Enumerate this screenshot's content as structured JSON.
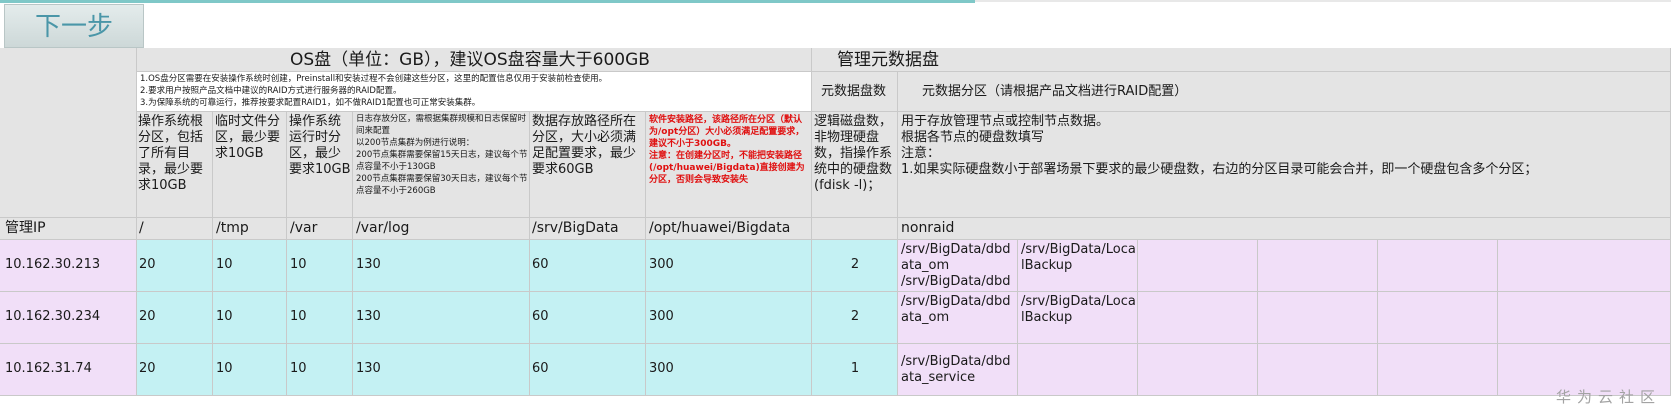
{
  "toolbar": {
    "next_label": "下一步"
  },
  "os_disk": {
    "title": "OS盘（单位：GB），建议OS盘容量大于600GB",
    "notes": "1.OS盘分区需要在安装操作系统时创建，Preinstall和安装过程不会创建这些分区，这里的配置信息仅用于安装前检查使用。\n2.要求用户按照产品文档中建议的RAID方式进行服务器的RAID配置。\n3.为保障系统的可靠运行，推荐按要求配置RAID1，如不做RAID1配置也可正常安装集群。",
    "descriptions": {
      "root": "操作系统根分区，包括了所有目录，最少要求10GB",
      "tmp": "临时文件分区，最少要求10GB",
      "var": "操作系统运行时分区，最少要求10GB",
      "log": "日志存放分区，需根据集群规模和日志保留时间来配置\n以200节点集群为例进行说明：\n200节点集群需要保留15天日志，建议每个节点容量不小于130GB\n200节点集群需要保留30天日志，建议每个节点容量不小于260GB",
      "srv": "数据存放路径所在分区，大小必须满足配置要求，最少要求60GB",
      "huawei": "软件安装路径，该路径所在分区（默认为/opt分区）大小必须满足配置要求，建议不小于300GB。\n注意：在创建分区时，不能把安装路径(/opt/huawei/Bigdata)直接创建为分区，否则会导致安装失"
    }
  },
  "meta_disk": {
    "title": "管理元数据盘",
    "count_header": "元数据盘数",
    "partition_header": "元数据分区（请根据产品文档进行RAID配置）",
    "count_desc": "逻辑磁盘数，非物理硬盘数，指操作系统中的硬盘数(fdisk -l)；",
    "partition_desc": "用于存放管理节点或控制节点数据。\n根据各节点的硬盘数填写\n注意：\n1.如果实际硬盘数小于部署场景下要求的最少硬盘数，右边的分区目录可能会合并，即一个硬盘包含多个分区；"
  },
  "columns": [
    "管理IP",
    "/",
    "/tmp",
    "/var",
    "/var/log",
    "/srv/BigData",
    "/opt/huawei/Bigdata",
    "",
    "nonraid"
  ],
  "rows": [
    {
      "ip": "10.162.30.213",
      "root": "20",
      "tmp": "10",
      "var": "10",
      "log": "130",
      "srv": "60",
      "huawei": "300",
      "meta_count": "2",
      "part1": "/srv/BigData/dbdata_om\n/srv/BigData/dbd",
      "part2": "/srv/BigData/LocalBackup"
    },
    {
      "ip": "10.162.30.234",
      "root": "20",
      "tmp": "10",
      "var": "10",
      "log": "130",
      "srv": "60",
      "huawei": "300",
      "meta_count": "2",
      "part1": "/srv/BigData/dbdata_om",
      "part2": "/srv/BigData/LocalBackup"
    },
    {
      "ip": "10.162.31.74",
      "root": "20",
      "tmp": "10",
      "var": "10",
      "log": "130",
      "srv": "60",
      "huawei": "300",
      "meta_count": "1",
      "part1": "/srv/BigData/dbdata_service",
      "part2": ""
    }
  ],
  "watermark": "华为云社区"
}
